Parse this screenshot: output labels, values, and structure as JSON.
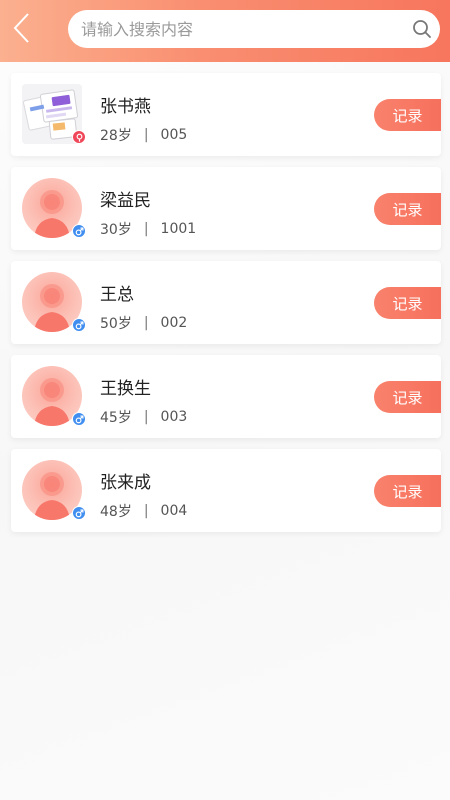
{
  "search": {
    "placeholder": "请输入搜索内容",
    "value": ""
  },
  "colors": {
    "header_start": "#fbb08f",
    "header_end": "#f7765d",
    "button": "#f6705d",
    "male_badge": "#3f8ef0",
    "female_badge": "#f0485a"
  },
  "patients": [
    {
      "name": "张书燕",
      "age": "28岁",
      "separator": "|",
      "id": "005",
      "avatar": "photo",
      "gender_icon": "female-icon",
      "record_label": "记录"
    },
    {
      "name": "梁益民",
      "age": "30岁",
      "separator": "|",
      "id": "1001",
      "avatar": "default",
      "gender_icon": "male-icon",
      "record_label": "记录"
    },
    {
      "name": "王总",
      "age": "50岁",
      "separator": "|",
      "id": "002",
      "avatar": "default",
      "gender_icon": "male-icon",
      "record_label": "记录"
    },
    {
      "name": "王换生",
      "age": "45岁",
      "separator": "|",
      "id": "003",
      "avatar": "default",
      "gender_icon": "male-icon",
      "record_label": "记录"
    },
    {
      "name": "张来成",
      "age": "48岁",
      "separator": "|",
      "id": "004",
      "avatar": "default",
      "gender_icon": "male-icon",
      "record_label": "记录"
    }
  ]
}
